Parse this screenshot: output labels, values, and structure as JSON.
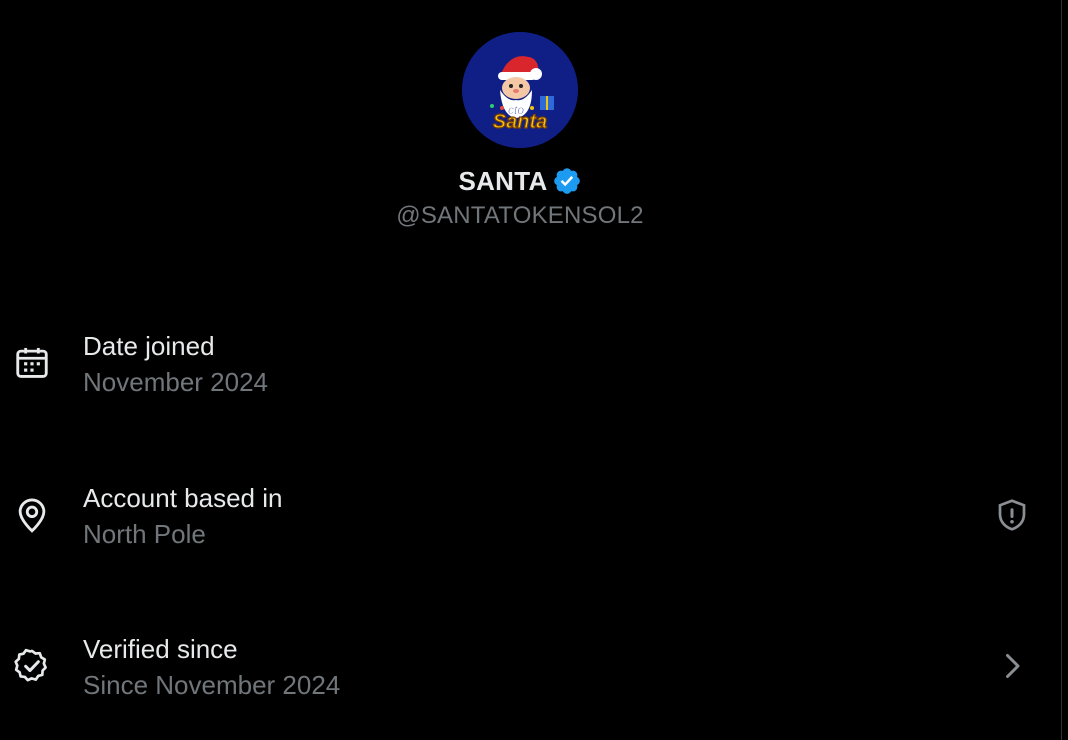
{
  "profile": {
    "name": "SANTA",
    "handle": "@SANTATOKENSOL2",
    "avatar_text_top": "cto",
    "avatar_text_main": "Santa",
    "verified": true
  },
  "rows": [
    {
      "title": "Date joined",
      "value": "November 2024",
      "icon": "calendar-icon"
    },
    {
      "title": "Account based in",
      "value": "North Pole",
      "icon": "location-pin-icon",
      "trail_icon": "shield-alert-icon"
    },
    {
      "title": "Verified since",
      "value": "Since November 2024",
      "icon": "verified-badge-icon",
      "trail_icon": "chevron-right-icon"
    }
  ],
  "colors": {
    "background": "#000000",
    "primary_text": "#e7e9ea",
    "secondary_text": "#71767b",
    "verified_blue": "#1d9bf0",
    "avatar_bg": "#0f1f86"
  }
}
